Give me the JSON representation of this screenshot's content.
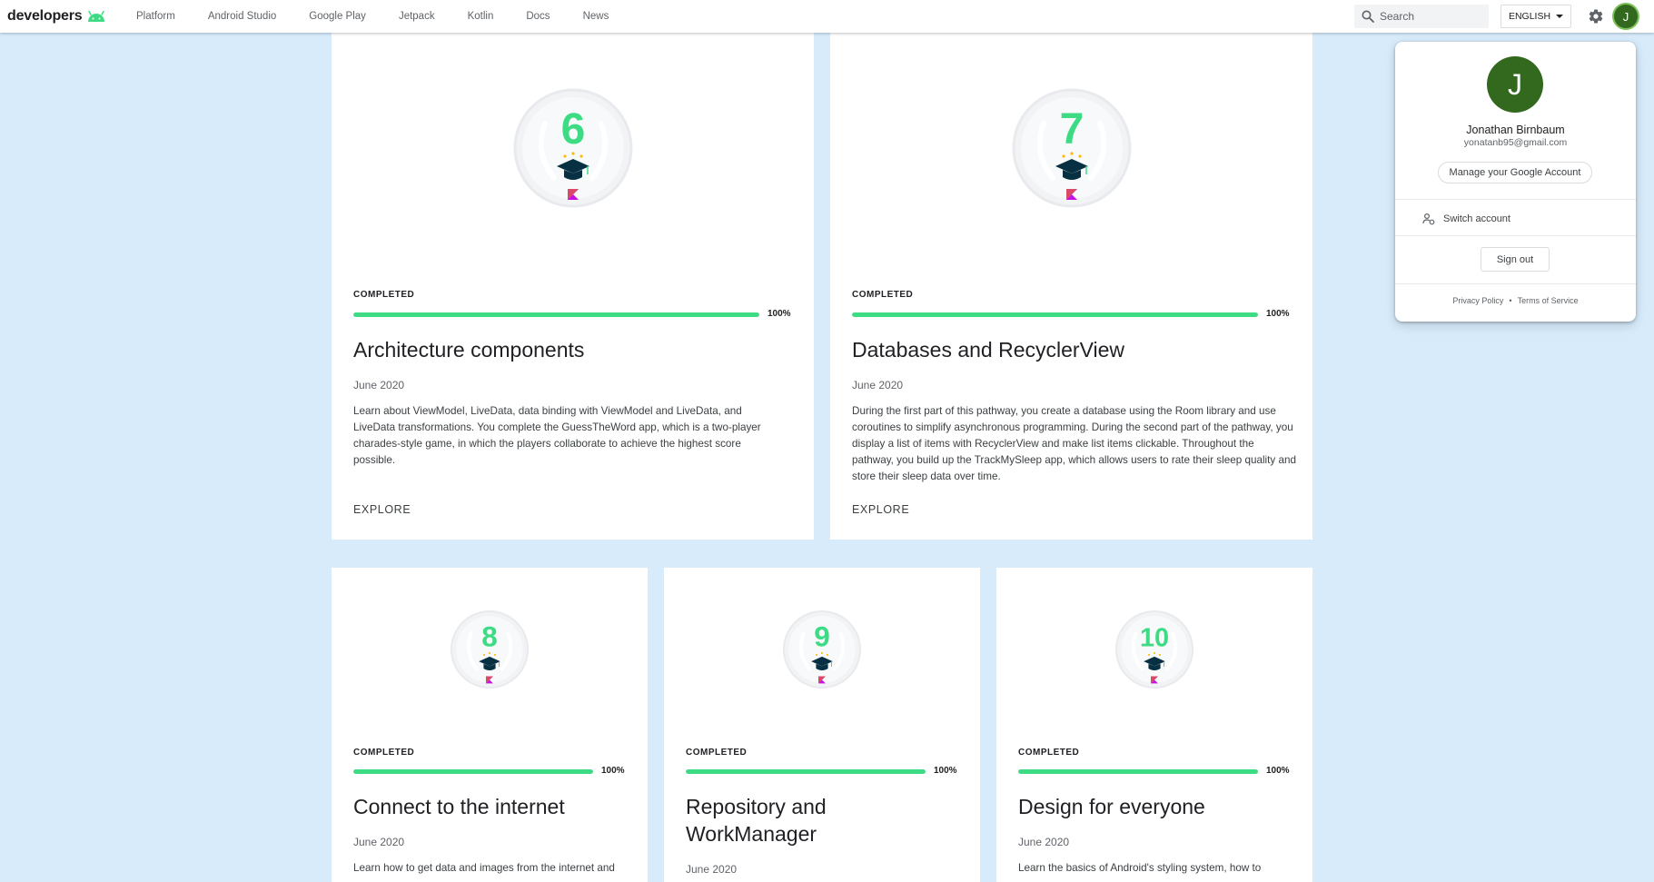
{
  "topbar": {
    "logo_text": "developers",
    "nav": [
      "Platform",
      "Android Studio",
      "Google Play",
      "Jetpack",
      "Kotlin",
      "Docs",
      "News"
    ],
    "search_placeholder": "Search",
    "language": "ENGLISH",
    "avatar_initial": "J"
  },
  "account": {
    "initial": "J",
    "name": "Jonathan Birnbaum",
    "email": "yonatanb95@gmail.com",
    "manage_label": "Manage your Google Account",
    "switch_label": "Switch account",
    "signout_label": "Sign out",
    "privacy_label": "Privacy Policy",
    "separator": "•",
    "terms_label": "Terms of Service"
  },
  "colors": {
    "progress": "#3ddc84",
    "badge_number": "#3ddc84",
    "avatar": "#33691e",
    "page_bg": "#d7ebfb"
  },
  "cards": [
    {
      "number": "6",
      "status": "COMPLETED",
      "progress": 1.0,
      "percent": "100%",
      "title": "Architecture components",
      "date": "June 2020",
      "description": "Learn about ViewModel, LiveData, data binding with ViewModel and LiveData, and LiveData transformations. You complete the GuessTheWord app, which is a two-player charades-style game, in which the players collaborate to achieve the highest score possible.",
      "action": "EXPLORE"
    },
    {
      "number": "7",
      "status": "COMPLETED",
      "progress": 1.0,
      "percent": "100%",
      "title": "Databases and RecyclerView",
      "date": "June 2020",
      "description": "During the first part of this pathway, you create a database using the Room library and use coroutines to simplify asynchronous programming. During the second part of the pathway, you display a list of items with RecyclerView and make list items clickable. Throughout the pathway, you build up the TrackMySleep app, which allows users to rate their sleep quality and store their sleep data over time.",
      "action": "EXPLORE"
    },
    {
      "number": "8",
      "status": "COMPLETED",
      "progress": 1.0,
      "percent": "100%",
      "title": "Connect to the internet",
      "date": "June 2020",
      "description": "Learn how to get data and images from the internet and"
    },
    {
      "number": "9",
      "status": "COMPLETED",
      "progress": 1.0,
      "percent": "100%",
      "title": "Repository and WorkManager",
      "date": "June 2020"
    },
    {
      "number": "10",
      "status": "COMPLETED",
      "progress": 1.0,
      "percent": "100%",
      "title": "Design for everyone",
      "date": "June 2020",
      "description": "Learn the basics of Android's styling system, how to"
    }
  ]
}
